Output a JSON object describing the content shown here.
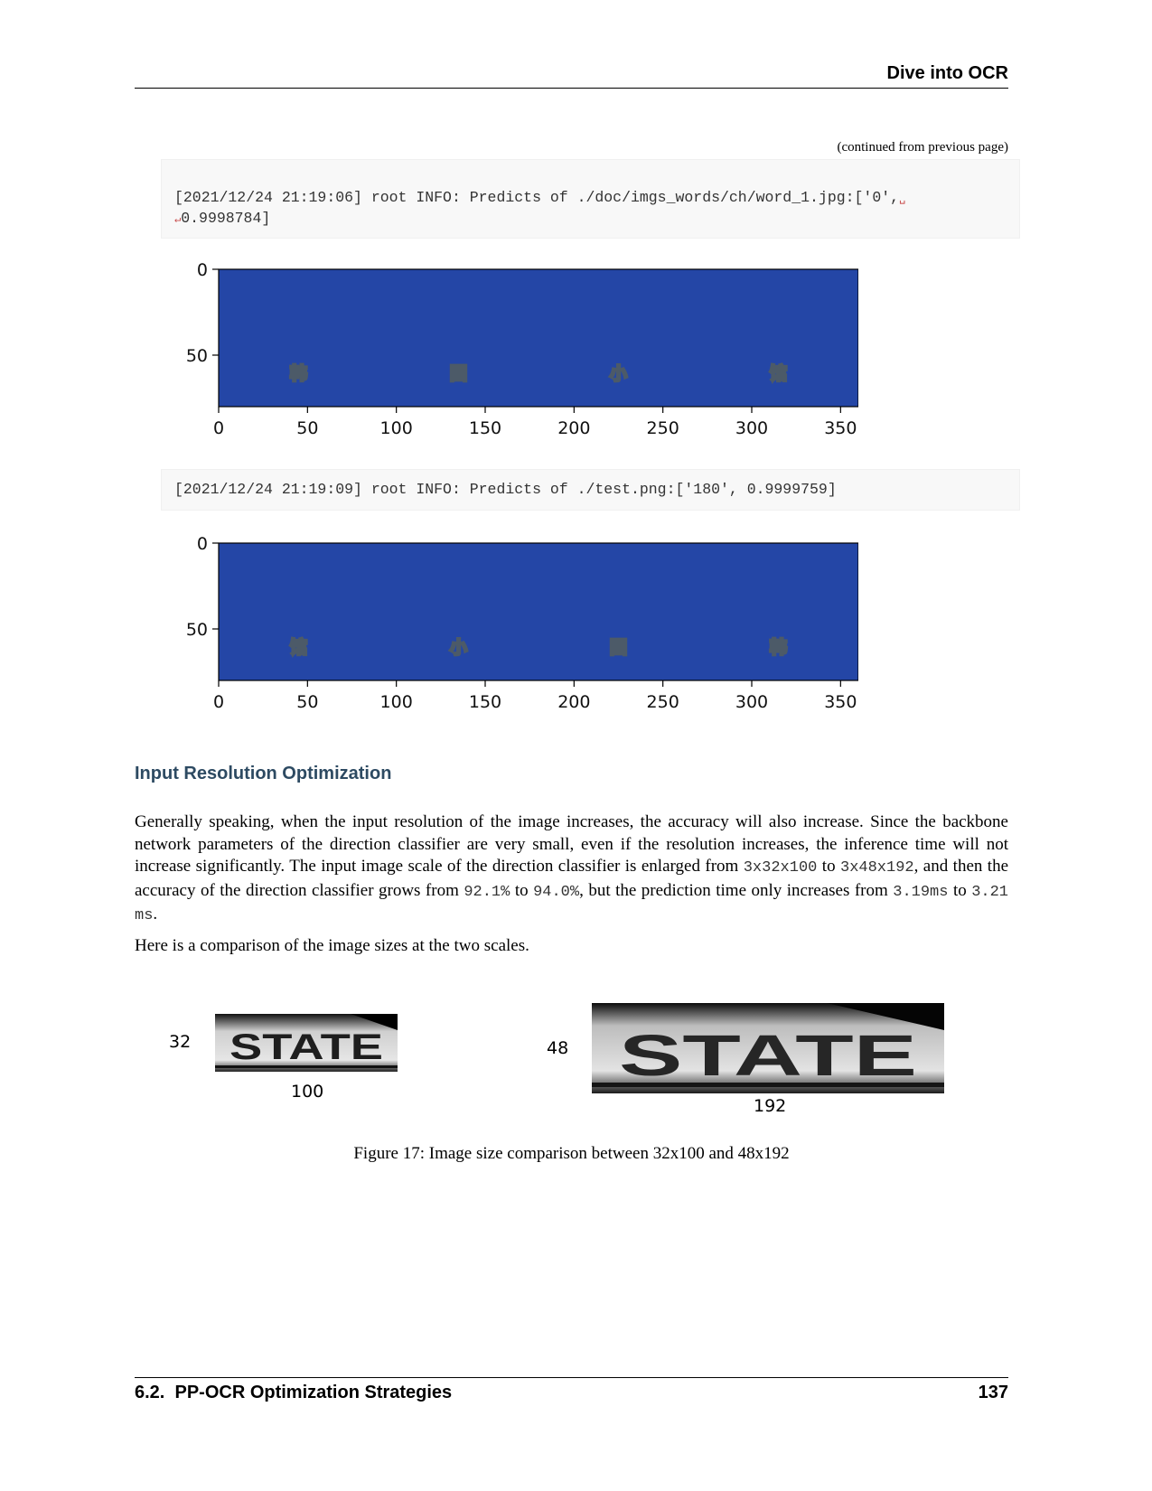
{
  "header": {
    "title": "Dive into OCR"
  },
  "continued_note": "(continued from previous page)",
  "code_blocks": [
    {
      "line1": "[2021/12/24 21:19:06] root INFO: Predicts of ./doc/imgs_words/ch/word_1.jpg:['0',",
      "wrap_marker": "↵",
      "line2": "0.9998784]"
    },
    {
      "line1": "[2021/12/24 21:19:09] root INFO: Predicts of ./test.png:['180', 0.9999759]"
    }
  ],
  "plots": [
    {
      "x_ticks": [
        "0",
        "50",
        "100",
        "150",
        "200",
        "250",
        "300",
        "350"
      ],
      "y_ticks": [
        "0",
        "50"
      ],
      "characters": [
        "韩",
        "国",
        "小",
        "馆"
      ],
      "image_background": "#2446a6",
      "glyph_color": "#8fa2b4"
    },
    {
      "x_ticks": [
        "0",
        "50",
        "100",
        "150",
        "200",
        "250",
        "300",
        "350"
      ],
      "y_ticks": [
        "0",
        "50"
      ],
      "characters": [
        "馆",
        "小",
        "国",
        "韩"
      ],
      "image_background": "#2446a6",
      "glyph_color": "#8fa2b4"
    }
  ],
  "section": {
    "title": "Input Resolution Optimization"
  },
  "paragraph1": {
    "t1": "Generally speaking, when the input resolution of the image increases, the accuracy will also increase. Since the backbone network parameters of the direction classifier are very small, even if the resolution increases, the inference time will not increase significantly. The input image scale of the direction classifier is enlarged from ",
    "c1": "3x32x100",
    "t2": " to ",
    "c2": "3x48x192",
    "t3": ", and then the accuracy of the direction classifier grows from ",
    "c3": "92.1%",
    "t4": " to ",
    "c4": "94.0%",
    "t5": ", but the prediction time only increases from ",
    "c5": "3.19ms",
    "t6": " to ",
    "c6": "3.21 ms",
    "t7": "."
  },
  "paragraph2": "Here is a comparison of the image sizes at the two scales.",
  "figure": {
    "small": {
      "height_label": "32",
      "width_label": "100",
      "word": "STATE"
    },
    "large": {
      "height_label": "48",
      "width_label": "192",
      "word": "STATE"
    },
    "caption": "Figure 17: Image size comparison between 32x100 and 48x192"
  },
  "footer": {
    "section": "6.2.  PP-OCR Optimization Strategies",
    "page": "137"
  }
}
